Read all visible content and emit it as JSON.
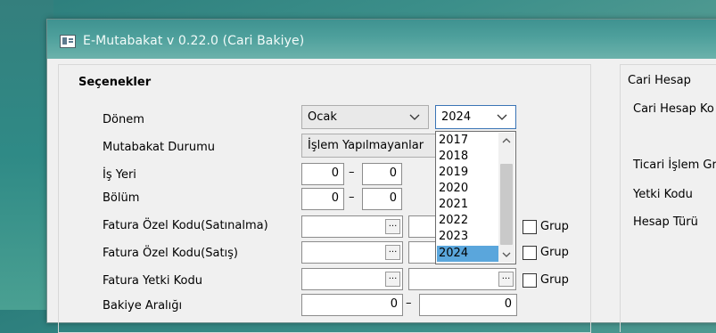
{
  "window": {
    "title": "E-Mutabakat v 0.22.0 (Cari Bakiye)"
  },
  "options": {
    "title": "Seçenekler",
    "period": {
      "label": "Dönem",
      "month": "Ocak",
      "year": "2024"
    },
    "reconciliation_status": {
      "label": "Mutabakat Durumu",
      "value": "İşlem Yapılmayanlar"
    },
    "workplace": {
      "label": "İş Yeri",
      "from": "0",
      "to": "0"
    },
    "department": {
      "label": "Bölüm",
      "from": "0",
      "to": "0"
    },
    "invoice_special_code_purchase": {
      "label": "Fatura Özel Kodu(Satınalma)",
      "group_label": "Grup"
    },
    "invoice_special_code_sales": {
      "label": "Fatura Özel Kodu(Satış)",
      "group_label": "Grup"
    },
    "invoice_auth_code": {
      "label": "Fatura Yetki Kodu",
      "group_label": "Grup"
    },
    "balance_range": {
      "label": "Bakiye Aralığı",
      "from": "0",
      "to": "0"
    }
  },
  "range_separator": "–",
  "browse_label": "...",
  "year_dropdown": {
    "items": [
      "2017",
      "2018",
      "2019",
      "2020",
      "2021",
      "2022",
      "2023",
      "2024"
    ],
    "selected": "2024"
  },
  "account": {
    "title": "Cari Hesap",
    "account_code_label": "Cari Hesap Ko",
    "trade_group_label": "Ticari İşlem Gr",
    "auth_code_label": "Yetki Kodu",
    "account_type_label": "Hesap Türü"
  },
  "colors": {
    "selection": "#5aa6dc",
    "title_bar": "#4ea09c",
    "focus_border": "#3a74b5"
  }
}
